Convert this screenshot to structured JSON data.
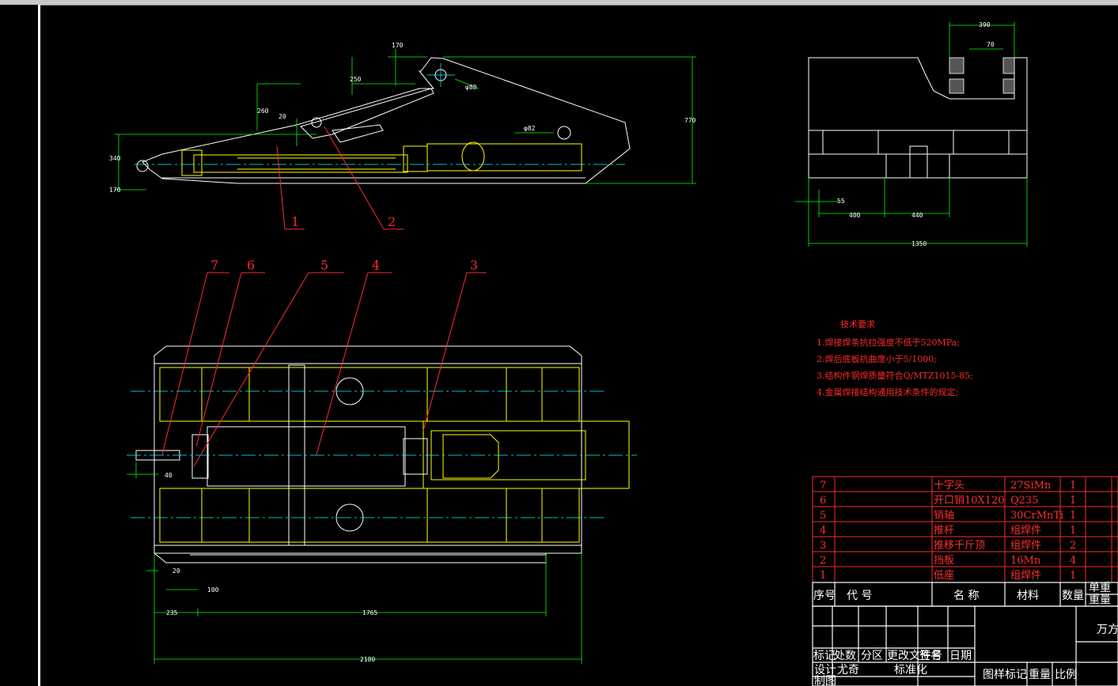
{
  "drawing": {
    "callouts": [
      "1",
      "2",
      "3",
      "4",
      "5",
      "6",
      "7"
    ],
    "side_view_dims": {
      "d170_top": "170",
      "d250": "250",
      "d260": "260",
      "d20": "20",
      "d340": "340",
      "d170_left": "170",
      "d770": "770",
      "phi1": "φ88",
      "phi2": "φ82"
    },
    "end_view_dims": {
      "d390": "390",
      "d70": "70",
      "d55": "55",
      "d400": "400",
      "d440": "440",
      "d1350": "1350"
    },
    "plan_view_dims": {
      "d40": "40",
      "d20": "20",
      "d100": "100",
      "d235": "235",
      "d1765": "1765",
      "d2180": "2180"
    }
  },
  "notes": {
    "title": "技术要求",
    "lines": [
      "1.焊接焊条抗拉强度不低于520MPa;",
      "2.焊后底板抗曲度小于5/1000;",
      "3.结构件钢焊质量符合Q/MTZ1015-85;",
      "4.金属焊接结构通用技术条件的规定;"
    ]
  },
  "bom": {
    "rows": [
      {
        "no": "7",
        "name": "十字头",
        "material": "27SiMn",
        "qty": "1"
      },
      {
        "no": "6",
        "name": "开口销10X120",
        "material": "Q235",
        "qty": "1"
      },
      {
        "no": "5",
        "name": "销轴",
        "material": "30CrMnTi",
        "qty": "1"
      },
      {
        "no": "4",
        "name": "推杆",
        "material": "组焊件",
        "qty": "1"
      },
      {
        "no": "3",
        "name": "推移千斤顶",
        "material": "组焊件",
        "qty": "2"
      },
      {
        "no": "2",
        "name": "挡板",
        "material": "16Mn",
        "qty": "4"
      },
      {
        "no": "1",
        "name": "低座",
        "material": "组焊件",
        "qty": "1"
      }
    ],
    "headers": {
      "no": "序号",
      "code": "代  号",
      "name": "名  称",
      "material": "材料",
      "qty": "数量",
      "unit_weight": "单重",
      "weight": "重量"
    }
  },
  "titleblock": {
    "row1": [
      "标记",
      "处数",
      "分区",
      "更改文件号",
      "签名",
      "日期"
    ],
    "design_label": "设计",
    "designer": "尤奇",
    "std_label": "标准化",
    "drafting_label": "制图",
    "mark_label": "图样标记",
    "weight_label": "重量",
    "scale_label": "比例",
    "company": "万方"
  }
}
